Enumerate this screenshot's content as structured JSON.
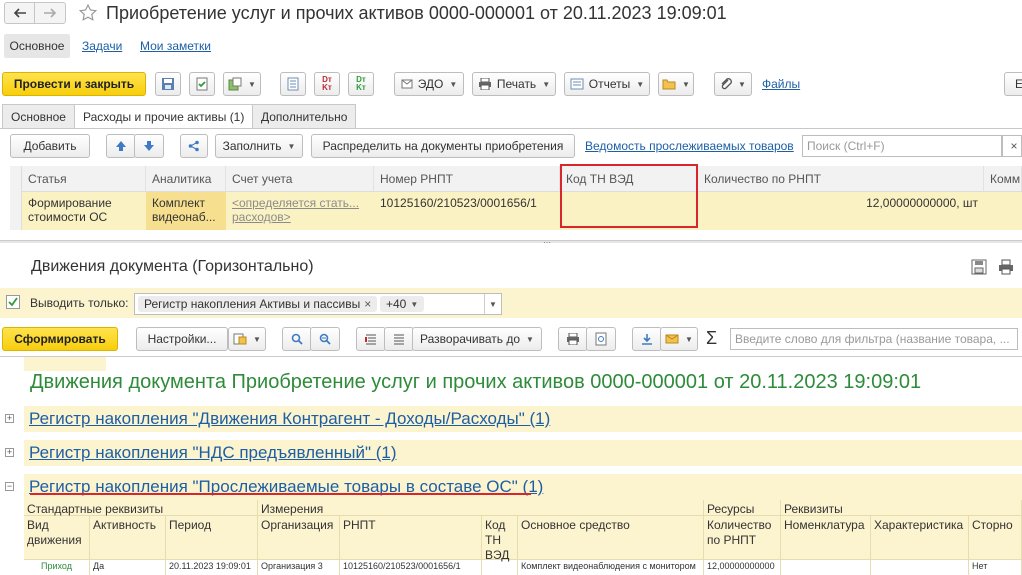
{
  "window": {
    "title": "Приобретение услуг и прочих активов 0000-000001 от 20.11.2023 19:09:01"
  },
  "nav_tabs": [
    "Основное",
    "Задачи",
    "Мои заметки"
  ],
  "toolbar": {
    "post_close": "Провести и закрыть",
    "edo": "ЭДО",
    "print": "Печать",
    "reports": "Отчеты",
    "files": "Файлы",
    "more": "Е"
  },
  "doc_tabs": [
    "Основное",
    "Расходы и прочие активы (1)",
    "Дополнительно"
  ],
  "table_toolbar": {
    "add": "Добавить",
    "fill": "Заполнить",
    "distribute": "Распределить на документы приобретения",
    "tracked_link": "Ведомость прослеживаемых товаров",
    "search_placeholder": "Поиск (Ctrl+F)"
  },
  "table": {
    "columns": [
      "Статья",
      "Аналитика",
      "Счет учета",
      "Номер РНПТ",
      "Код ТН ВЭД",
      "Количество по РНПТ",
      "Комм"
    ],
    "row": {
      "statya": "Формирование стоимости ОС",
      "analitika": "Комплект видеонаб...",
      "schet": "<определяется стать... расходов>",
      "rnpt": "10125160/210523/0001656/1",
      "kod": "",
      "qty": "12,00000000000, шт",
      "comm": ""
    }
  },
  "movements": {
    "title": "Движения документа (Горизонтально)",
    "filter_label": "Выводить только:",
    "filter_tag": "Регистр накопления Активы и пассивы",
    "filter_more": "+40",
    "generate": "Сформировать",
    "settings": "Настройки...",
    "expand": "Разворачивать до",
    "filter_placeholder": "Введите слово для фильтра (название товара, ...",
    "report_title": "Движения документа Приобретение услуг и прочих активов 0000-000001 от 20.11.2023 19:09:01",
    "registers": [
      "Регистр накопления \"Движения Контрагент - Доходы/Расходы\" (1)",
      "Регистр накопления \"НДС предъявленный\" (1)",
      "Регистр накопления \"Прослеживаемые товары в составе ОС\" (1)"
    ],
    "groups": [
      "Стандартные реквизиты",
      "Измерения",
      "Ресурсы",
      "Реквизиты"
    ],
    "cols": [
      "Вид движения",
      "Активность",
      "Период",
      "Организация",
      "РНПТ",
      "Код ТН ВЭД",
      "Основное средство",
      "Количество по РНПТ",
      "Номенклатура",
      "Характеристика",
      "Сторно"
    ],
    "row": [
      "Приход",
      "Да",
      "20.11.2023 19:09:01",
      "Организация 3",
      "10125160/210523/0001656/1",
      "",
      "Комплект видеонаблюдения с монитором",
      "12,00000000000",
      "",
      "",
      "Нет"
    ]
  },
  "colors": {
    "accent_yellow": "#f7ce0c",
    "link_blue": "#1d5fa5",
    "report_green": "#2e8b3a",
    "highlight_red": "#d9262c"
  }
}
